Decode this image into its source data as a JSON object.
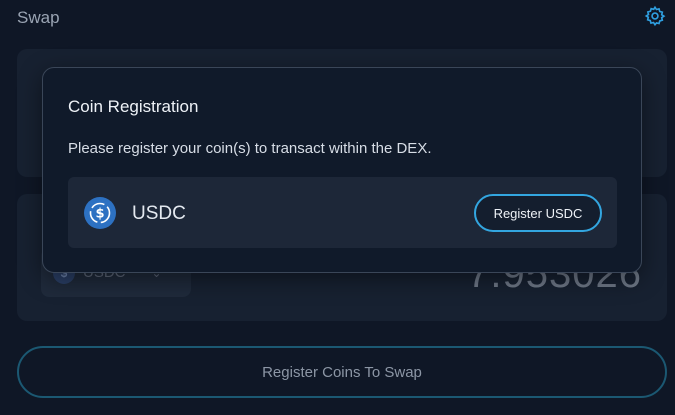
{
  "page": {
    "title": "Swap",
    "settings_icon": "gear-icon"
  },
  "swap_form": {
    "to_token": {
      "symbol": "USDC",
      "icon": "usdc-coin-icon"
    },
    "to_amount": "7.953026",
    "submit_label": "Register Coins To Swap"
  },
  "modal": {
    "title": "Coin Registration",
    "description": "Please register your coin(s) to transact within the DEX.",
    "coins": [
      {
        "symbol": "USDC",
        "icon": "usdc-coin-icon",
        "button_label": "Register USDC"
      }
    ]
  },
  "colors": {
    "background": "#0f1726",
    "card": "#172131",
    "accent": "#33a6e0",
    "usdc_blue": "#2d71c2"
  }
}
